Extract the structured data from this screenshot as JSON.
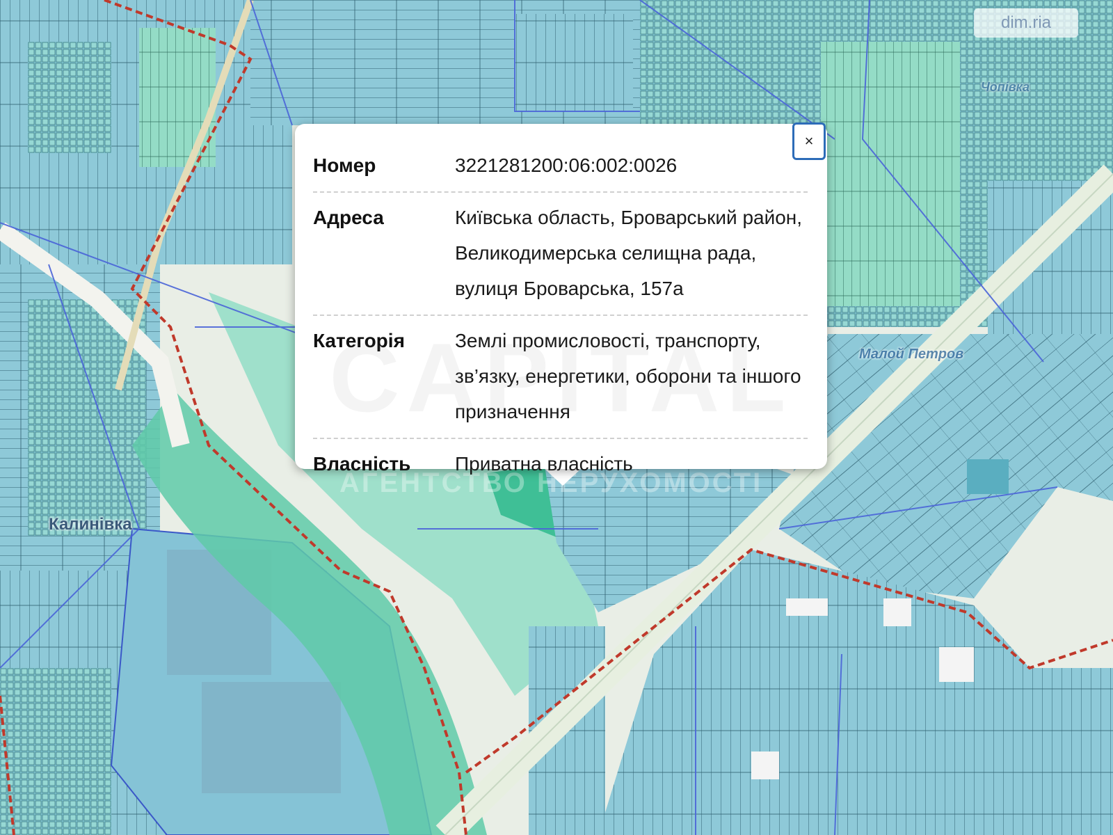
{
  "map": {
    "colors": {
      "parcel_blue": "#8ec9d8",
      "parcel_green": "#8fdcc4",
      "parcel_teal": "#52c4a4",
      "boundary_red": "#c0392b",
      "line_blue": "#4a64d8",
      "road": "#e5efe2"
    },
    "labels": {
      "kalynivka": "Калинівка",
      "malyi_petriv": "Малой Петров",
      "top_right": "Чопівка"
    }
  },
  "watermarks": {
    "corner": "dim.ria",
    "popup_big": "CAPITAL",
    "popup_sub": "АГЕНТСТВО НЕРУХОМОСТІ"
  },
  "popup": {
    "close_label": "×",
    "rows": [
      {
        "key": "Номер",
        "value": "3221281200:06:002:0026"
      },
      {
        "key": "Адреса",
        "value": "Київська область, Броварський район, Великодимерська селищна рада, вулиця Броварська, 157а"
      },
      {
        "key": "Категорія",
        "value": "Землі промисловості, транспорту, зв’язку, енергетики, оборони та іншого призначення"
      },
      {
        "key": "Власність",
        "value": "Приватна власність"
      }
    ]
  }
}
